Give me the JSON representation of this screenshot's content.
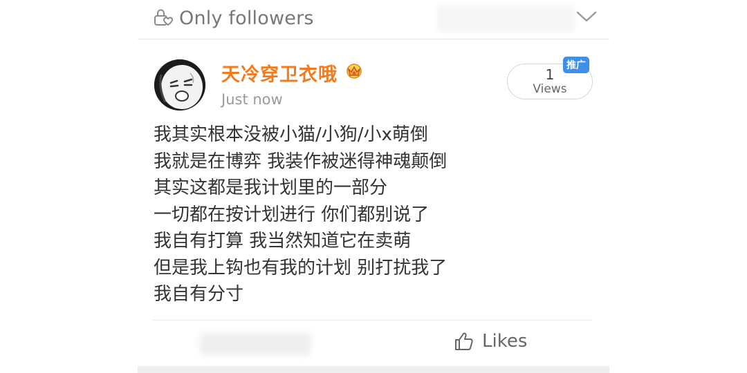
{
  "privacy": {
    "icon": "lock-people-icon",
    "label": "Only  followers"
  },
  "post": {
    "author": "天冷穿卫衣哦",
    "author_badge_icon": "crown-badge-icon",
    "time": "Just  now",
    "views": {
      "count": "1",
      "label": "Views"
    },
    "promo_badge": "推广",
    "lines": [
      "我其实根本没被小猫/小狗/小x萌倒",
      "我就是在博弈  我装作被迷得神魂颠倒",
      "其实这都是我计划里的一部分",
      "一切都在按计划进行  你们都别说了",
      "我自有打算  我当然知道它在卖萌",
      "但是我上钩也有我的计划  别打扰我了",
      "我自有分寸"
    ]
  },
  "footer": {
    "likes_label": "Likes",
    "like_icon": "thumbs-up-icon"
  },
  "colors": {
    "author": "#f07c1f",
    "badge": "#3e8fe6",
    "text": "#333333"
  }
}
